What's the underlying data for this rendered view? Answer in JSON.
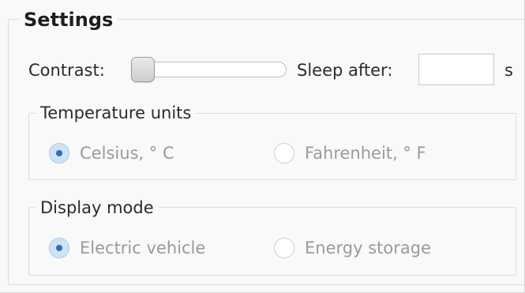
{
  "settings": {
    "title": "Settings",
    "contrast_label": "Contrast:",
    "contrast_level": 0.0,
    "sleep_label": "Sleep after:",
    "sleep_value": "",
    "sleep_unit": "s"
  },
  "temperature_units": {
    "title": "Temperature units",
    "options": [
      {
        "label": "Celsius, ° C",
        "selected": true
      },
      {
        "label": "Fahrenheit, ° F",
        "selected": false
      }
    ]
  },
  "display_mode": {
    "title": "Display mode",
    "options": [
      {
        "label": "Electric vehicle",
        "selected": true
      },
      {
        "label": "Energy storage",
        "selected": false
      }
    ]
  }
}
